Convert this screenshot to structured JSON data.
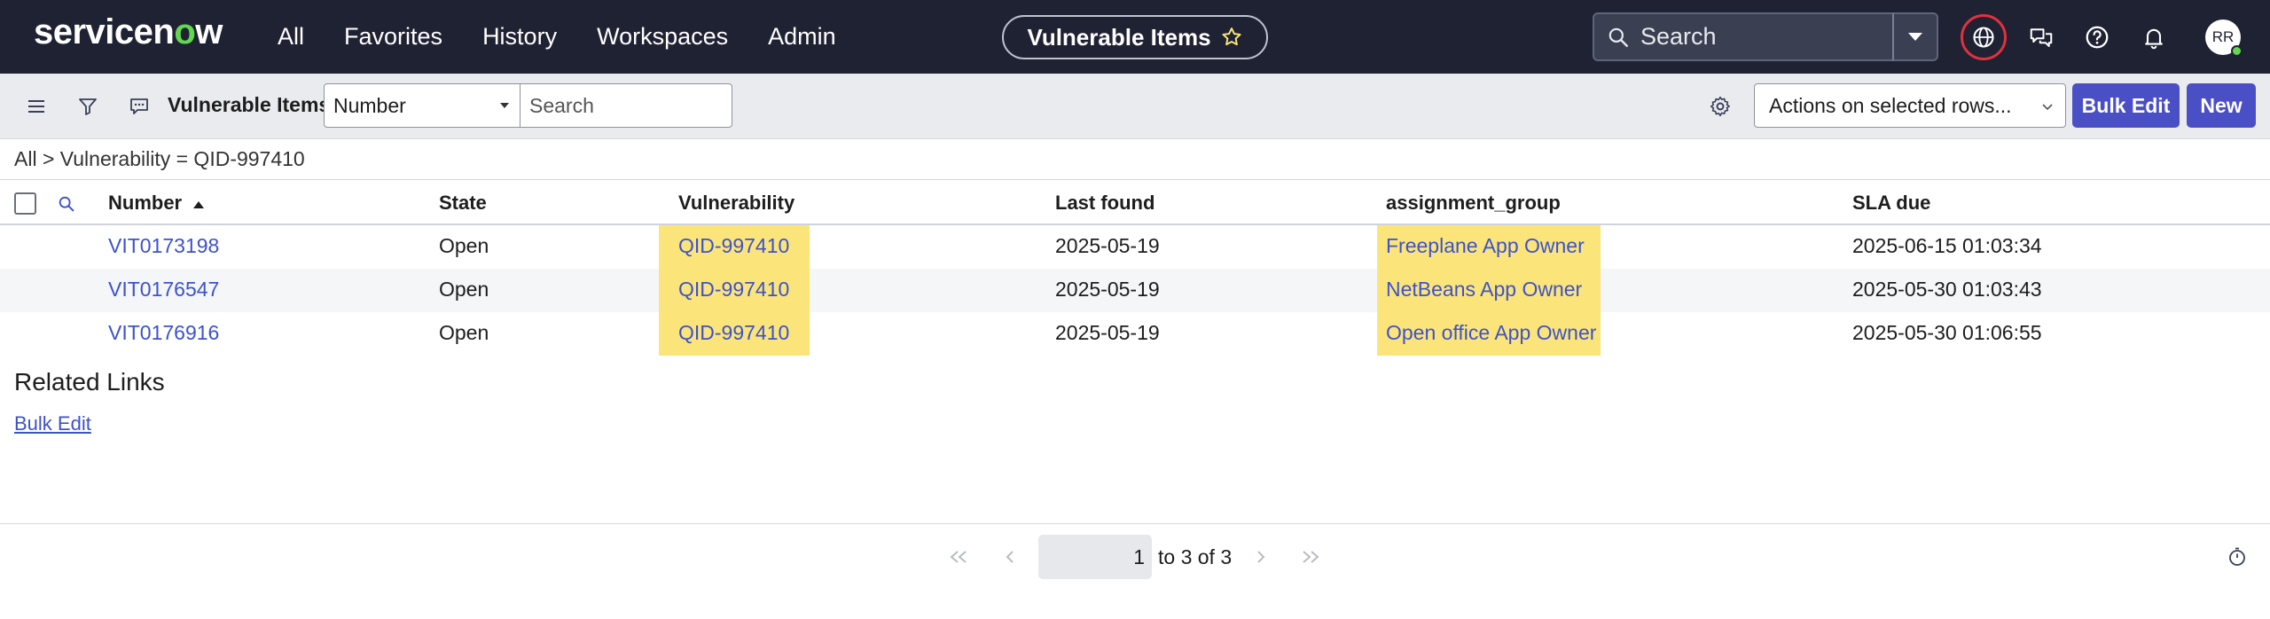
{
  "topnav": {
    "brand_pre": "servicen",
    "brand_o": "o",
    "brand_post": "w",
    "links": [
      "All",
      "Favorites",
      "History",
      "Workspaces",
      "Admin"
    ],
    "context_pill": "Vulnerable Items",
    "search_placeholder": "Search",
    "avatar_initials": "RR"
  },
  "toolbar": {
    "list_title": "Vulnerable Items",
    "field_select_value": "Number",
    "search_placeholder": "Search",
    "actions_select_value": "Actions on selected rows...",
    "bulk_edit_label": "Bulk Edit",
    "new_label": "New"
  },
  "breadcrumb": {
    "root": "All",
    "separator": ">",
    "condition": "Vulnerability = QID-997410"
  },
  "table": {
    "columns": [
      "Number",
      "State",
      "Vulnerability",
      "Last found",
      "assignment_group",
      "SLA due"
    ],
    "sort_column": "Number",
    "sort_direction": "ascending",
    "rows": [
      {
        "number": "VIT0173198",
        "state": "Open",
        "vulnerability": "QID-997410",
        "last_found": "2025-05-19",
        "assignment_group": "Freeplane App Owner",
        "sla_due": "2025-06-15 01:03:34"
      },
      {
        "number": "VIT0176547",
        "state": "Open",
        "vulnerability": "QID-997410",
        "last_found": "2025-05-19",
        "assignment_group": "NetBeans App Owner",
        "sla_due": "2025-05-30 01:03:43"
      },
      {
        "number": "VIT0176916",
        "state": "Open",
        "vulnerability": "QID-997410",
        "last_found": "2025-05-19",
        "assignment_group": "Open office App Owner",
        "sla_due": "2025-05-30 01:06:55"
      }
    ],
    "highlight_color": "#fbe57a"
  },
  "related": {
    "title": "Related Links",
    "links": [
      "Bulk Edit"
    ]
  },
  "pagination": {
    "current_page": "1",
    "range_text": "to 3 of 3"
  },
  "colors": {
    "nav_bg": "#1f2233",
    "accent_button": "#4b4fc6",
    "link": "#3d52cc",
    "brand_o": "#62d84e",
    "globe_ring": "#e0313f"
  },
  "icons": {
    "nav": [
      "star-icon",
      "search-icon",
      "chevron-down-icon",
      "globe-icon",
      "chat-icon",
      "help-icon",
      "bell-icon"
    ],
    "toolbar": [
      "hamburger-icon",
      "filter-icon",
      "comment-icon",
      "gear-icon"
    ],
    "pager": [
      "first-page-icon",
      "prev-page-icon",
      "next-page-icon",
      "last-page-icon",
      "timer-icon"
    ]
  }
}
